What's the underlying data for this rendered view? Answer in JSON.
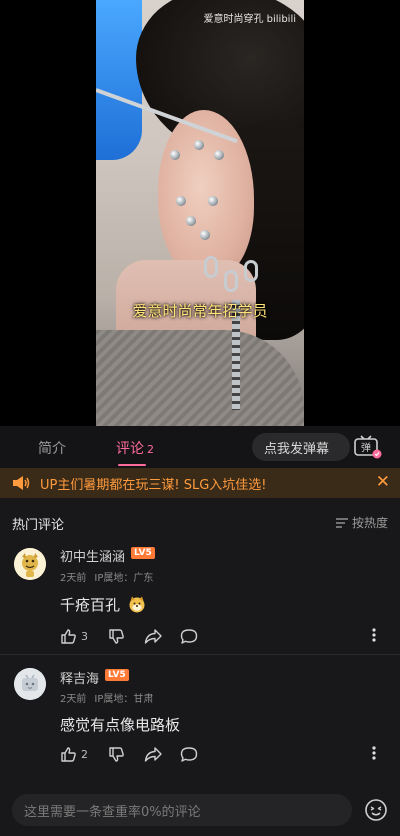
{
  "video": {
    "watermark": "爱意时尚穿孔 bilibili",
    "subtitle": "爱意时尚常年招学员"
  },
  "tabs": {
    "intro_label": "简介",
    "comments_label": "评论",
    "comments_count": "2",
    "danmaku_placeholder": "点我发弹幕",
    "danmaku_toggle_label": "弹"
  },
  "notice": {
    "text": "UP主们暑期都在玩三谋! SLG入坑佳选!",
    "close_label": "✕"
  },
  "comments_section": {
    "title": "热门评论",
    "sort_label": "按热度"
  },
  "comments": [
    {
      "username": "初中生涵涵",
      "level": "LV5",
      "time": "2天前",
      "ip_location": "IP属地：广东",
      "text": "千疮百孔",
      "like_count": "3"
    },
    {
      "username": "释吉海",
      "level": "LV5",
      "time": "2天前",
      "ip_location": "IP属地：甘肃",
      "text": "感觉有点像电路板",
      "like_count": "2"
    }
  ],
  "bottom_bar": {
    "placeholder": "这里需要一条查重率0%的评论"
  },
  "colors": {
    "accent_pink": "#ff6b9a",
    "notice_orange": "#ff9b3d",
    "level_badge": "#ff7a36",
    "background": "#18181a"
  }
}
